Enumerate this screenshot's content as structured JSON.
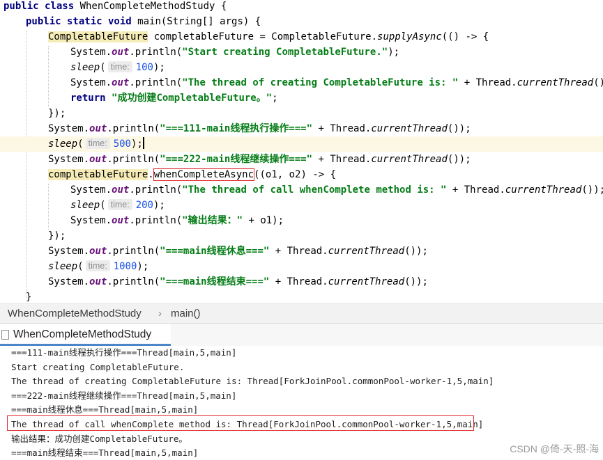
{
  "editor": {
    "lines": [
      {
        "tokens": [
          {
            "t": "public class ",
            "c": "kw"
          },
          {
            "t": "WhenCompleteMethodStudy {"
          }
        ]
      },
      {
        "tokens": [
          {
            "t": "public static void ",
            "c": "kw"
          },
          {
            "t": "main(String[] args) {"
          }
        ]
      },
      {
        "tokens": [
          {
            "t": "CompletableFuture",
            "c": "cf-hl"
          },
          {
            "t": " completableFuture = CompletableFuture."
          },
          {
            "t": "supplyAsync",
            "c": "it"
          },
          {
            "t": "(() -> {"
          }
        ]
      },
      {
        "tokens": [
          {
            "t": "System."
          },
          {
            "t": "out",
            "c": "fld"
          },
          {
            "t": ".println("
          },
          {
            "t": "\"Start creating CompletableFuture.\"",
            "c": "str"
          },
          {
            "t": ");"
          }
        ]
      },
      {
        "tokens": [
          {
            "t": "sleep",
            "c": "it"
          },
          {
            "t": "("
          },
          {
            "hint": "time:"
          },
          {
            "t": "100",
            "c": "num"
          },
          {
            "t": ");"
          }
        ]
      },
      {
        "tokens": [
          {
            "t": "System."
          },
          {
            "t": "out",
            "c": "fld"
          },
          {
            "t": ".println("
          },
          {
            "t": "\"The thread of creating CompletableFuture is: \"",
            "c": "str"
          },
          {
            "t": " + Thread."
          },
          {
            "t": "currentThread",
            "c": "it"
          },
          {
            "t": "());"
          }
        ]
      },
      {
        "tokens": [
          {
            "t": "return ",
            "c": "kw"
          },
          {
            "t": "\"成功创建CompletableFuture。\"",
            "c": "str"
          },
          {
            "t": ";"
          }
        ]
      },
      {
        "tokens": [
          {
            "t": "});"
          }
        ]
      },
      {
        "tokens": [
          {
            "t": "System."
          },
          {
            "t": "out",
            "c": "fld"
          },
          {
            "t": ".println("
          },
          {
            "t": "\"===111-main线程执行操作===\"",
            "c": "str"
          },
          {
            "t": " + Thread."
          },
          {
            "t": "currentThread",
            "c": "it"
          },
          {
            "t": "());"
          }
        ]
      },
      {
        "tokens": [
          {
            "t": "sleep",
            "c": "it"
          },
          {
            "t": "("
          },
          {
            "hint": "time:"
          },
          {
            "t": "500",
            "c": "num"
          },
          {
            "t": ");"
          },
          {
            "caret": true
          }
        ]
      },
      {
        "tokens": [
          {
            "t": "System."
          },
          {
            "t": "out",
            "c": "fld"
          },
          {
            "t": ".println("
          },
          {
            "t": "\"===222-main线程继续操作===\"",
            "c": "str"
          },
          {
            "t": " + Thread."
          },
          {
            "t": "currentThread",
            "c": "it"
          },
          {
            "t": "());"
          }
        ]
      },
      {
        "tokens": [
          {
            "t": "completableFuture",
            "c": "cf-hl"
          },
          {
            "t": "."
          },
          {
            "t": "whenCompleteAsync",
            "c": "boxed"
          },
          {
            "t": "((o1, o2) -> {"
          }
        ]
      },
      {
        "tokens": [
          {
            "t": "System."
          },
          {
            "t": "out",
            "c": "fld"
          },
          {
            "t": ".println("
          },
          {
            "t": "\"The thread of call whenComplete method is: \"",
            "c": "str"
          },
          {
            "t": " + Thread."
          },
          {
            "t": "currentThread",
            "c": "it"
          },
          {
            "t": "());"
          }
        ]
      },
      {
        "tokens": [
          {
            "t": "sleep",
            "c": "it"
          },
          {
            "t": "("
          },
          {
            "hint": "time:"
          },
          {
            "t": "200",
            "c": "num"
          },
          {
            "t": ");"
          }
        ]
      },
      {
        "tokens": [
          {
            "t": "System."
          },
          {
            "t": "out",
            "c": "fld"
          },
          {
            "t": ".println("
          },
          {
            "t": "\"输出结果：\"",
            "c": "str"
          },
          {
            "t": " + o1);"
          }
        ]
      },
      {
        "tokens": [
          {
            "t": "});"
          }
        ]
      },
      {
        "tokens": [
          {
            "t": "System."
          },
          {
            "t": "out",
            "c": "fld"
          },
          {
            "t": ".println("
          },
          {
            "t": "\"===main线程休息===\"",
            "c": "str"
          },
          {
            "t": " + Thread."
          },
          {
            "t": "currentThread",
            "c": "it"
          },
          {
            "t": "());"
          }
        ]
      },
      {
        "tokens": [
          {
            "t": "sleep",
            "c": "it"
          },
          {
            "t": "("
          },
          {
            "hint": "time:"
          },
          {
            "t": "1000",
            "c": "num"
          },
          {
            "t": ");"
          }
        ]
      },
      {
        "tokens": [
          {
            "t": "System."
          },
          {
            "t": "out",
            "c": "fld"
          },
          {
            "t": ".println("
          },
          {
            "t": "\"===main线程结束===\"",
            "c": "str"
          },
          {
            "t": " + Thread."
          },
          {
            "t": "currentThread",
            "c": "it"
          },
          {
            "t": "());"
          }
        ]
      },
      {
        "tokens": [
          {
            "t": "}"
          }
        ]
      }
    ]
  },
  "breadcrumb": {
    "class_name": "WhenCompleteMethodStudy",
    "separator": "›",
    "method": "main()"
  },
  "run_panel": {
    "tab_label": "WhenCompleteMethodStudy",
    "output": [
      "===111-main线程执行操作===Thread[main,5,main]",
      "Start creating CompletableFuture.",
      "The thread of creating CompletableFuture is: Thread[ForkJoinPool.commonPool-worker-1,5,main]",
      "===222-main线程继续操作===Thread[main,5,main]",
      "===main线程休息===Thread[main,5,main]",
      "The thread of call whenComplete method is: Thread[ForkJoinPool.commonPool-worker-1,5,main]",
      "输出结果：成功创建CompletableFuture。",
      "===main线程结束===Thread[main,5,main]"
    ]
  },
  "watermark": "CSDN @倚-天-照-海",
  "colors": {
    "keyword": "#000080",
    "string": "#067d17",
    "number": "#1750eb",
    "field": "#660e7a",
    "highlight_box": "#e0262b",
    "caret_line": "#fdf8e3"
  }
}
